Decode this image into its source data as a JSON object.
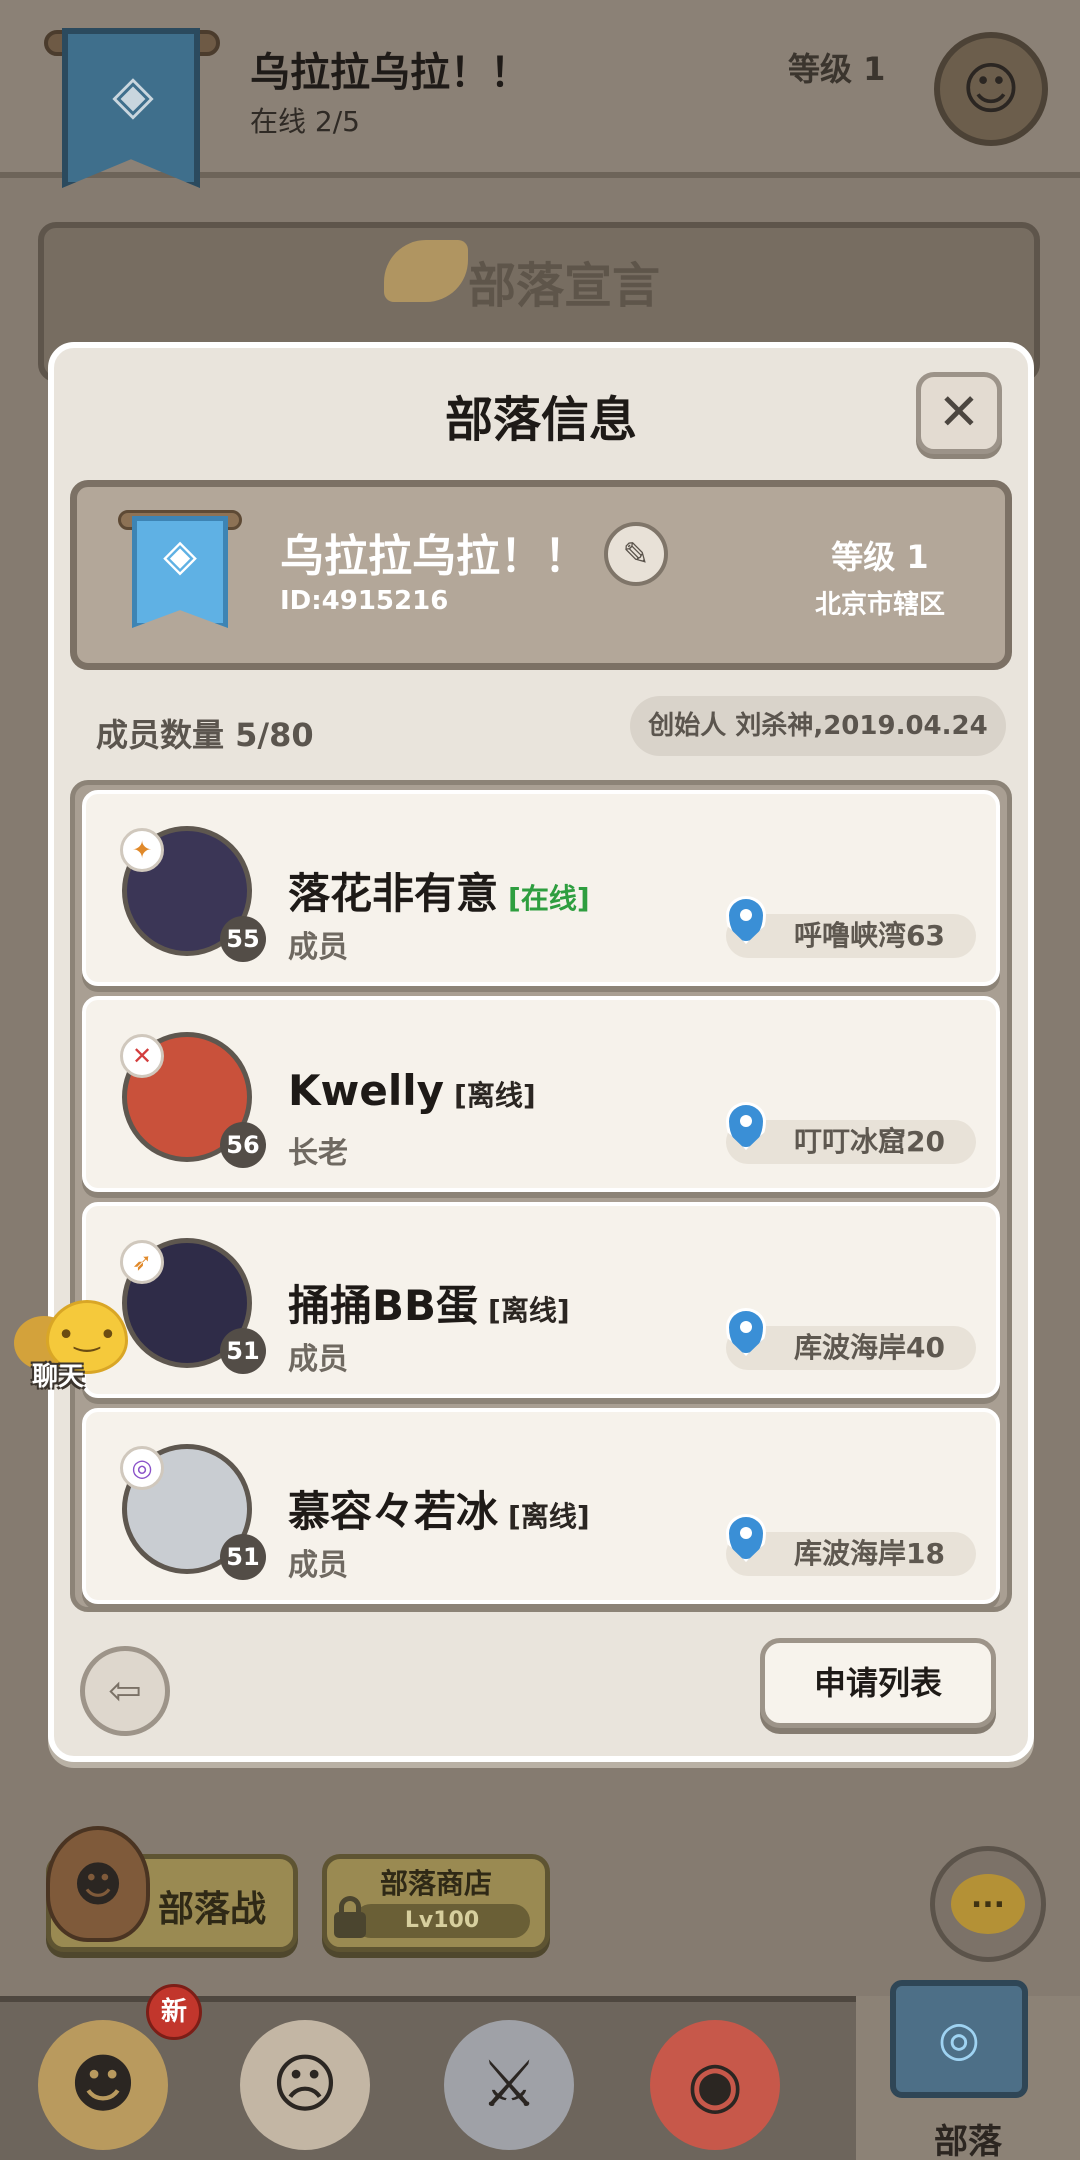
{
  "header": {
    "tribe_name": "乌拉拉乌拉！！",
    "online": "在线 2/5",
    "level": "等级 1"
  },
  "declaration": {
    "title": "部落宣言"
  },
  "modal": {
    "title": "部落信息",
    "close_label": "✕",
    "tribe": {
      "name": "乌拉拉乌拉！！",
      "id": "ID:4915216",
      "level": "等级 1",
      "region": "北京市辖区"
    },
    "member_count": "成员数量 5/80",
    "founder": "创始人 刘杀神,2019.04.24",
    "members": [
      {
        "name": "落花非有意",
        "status": "[在线]",
        "role": "成员",
        "level": "55",
        "location": "呼噜峡湾63"
      },
      {
        "name": "Kwelly",
        "status": "[离线]",
        "role": "长老",
        "level": "56",
        "location": "叮叮冰窟20"
      },
      {
        "name": "捅捅BB蛋",
        "status": "[离线]",
        "role": "成员",
        "level": "51",
        "location": "库波海岸40"
      },
      {
        "name": "慕容々若冰",
        "status": "[离线]",
        "role": "成员",
        "level": "51",
        "location": "库波海岸18"
      }
    ],
    "apply_list_label": "申请列表"
  },
  "chat_float": {
    "label": "聊天"
  },
  "bottom": {
    "tribe_war_label": "部落战",
    "tribe_shop_label": "部落商店",
    "tribe_shop_lock": "Lv100",
    "new_badge": "新",
    "active_tab_label": "部落",
    "chat_dots": "..."
  },
  "colors": {
    "online_status": "#2e9e3f",
    "location_pin": "#3a8fd6",
    "banner_blue": "#5fb1e4",
    "new_badge": "#c2362c"
  }
}
